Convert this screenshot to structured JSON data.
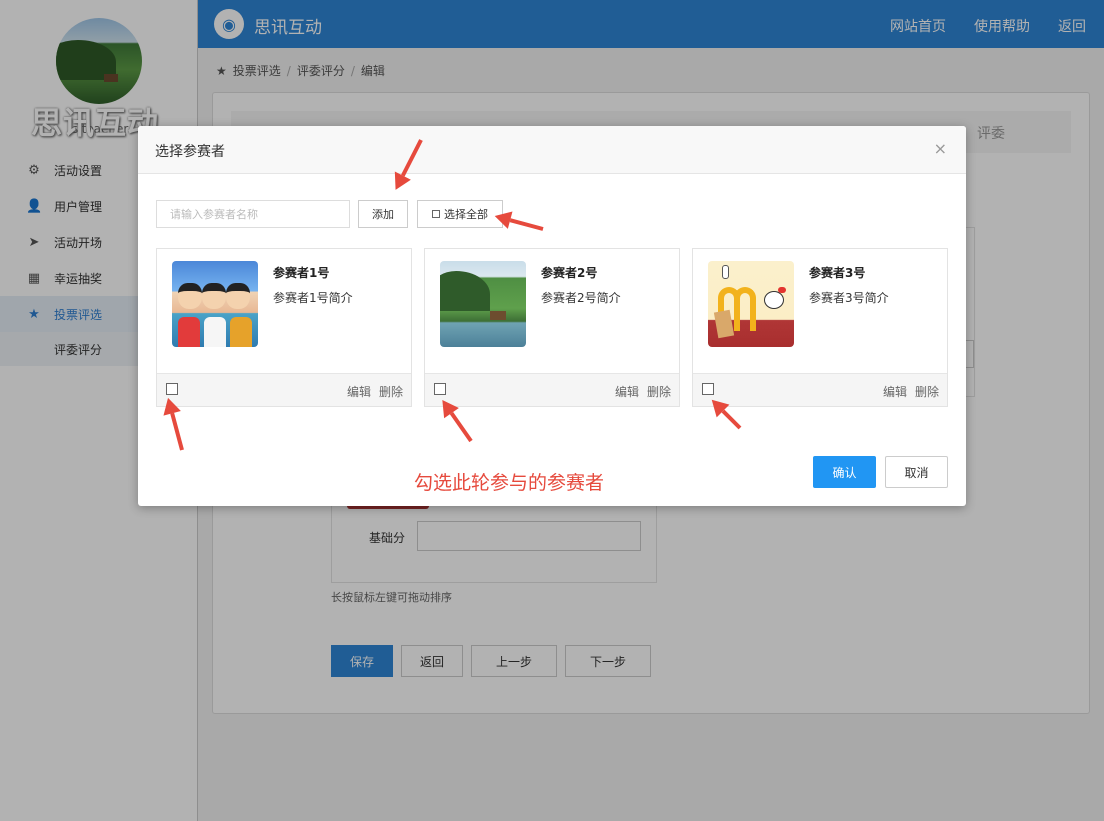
{
  "brand": {
    "watermark": "思讯互动",
    "username": "siteaener"
  },
  "sidebar": {
    "items": [
      {
        "label": "活动设置",
        "icon": "gears-icon"
      },
      {
        "label": "用户管理",
        "icon": "user-icon"
      },
      {
        "label": "活动开场",
        "icon": "send-icon"
      },
      {
        "label": "幸运抽奖",
        "icon": "lottery-icon"
      },
      {
        "label": "投票评选",
        "icon": "star-icon",
        "active": true
      },
      {
        "label": "评委评分",
        "sub": true
      }
    ]
  },
  "topbar": {
    "title": "思讯互动",
    "links": [
      "网站首页",
      "使用帮助",
      "返回"
    ],
    "color": "#2f86d6"
  },
  "breadcrumb": [
    "投票评选",
    "评委评分",
    "编辑"
  ],
  "background_form": {
    "last_step": "评委",
    "base_score_label": "基础分",
    "hint": "长按鼠标左键可拖动排序",
    "buttons": {
      "save": "保存",
      "back": "返回",
      "prev": "上一步",
      "next": "下一步"
    }
  },
  "modal": {
    "title": "选择参赛者",
    "close": "×",
    "search_placeholder": "请输入参赛者名称",
    "add_label": "添加",
    "select_all_label": "选择全部",
    "cards": [
      {
        "name": "参赛者1号",
        "desc": "参赛者1号简介",
        "edit": "编辑",
        "delete": "删除",
        "checked": false
      },
      {
        "name": "参赛者2号",
        "desc": "参赛者2号简介",
        "edit": "编辑",
        "delete": "删除",
        "checked": false
      },
      {
        "name": "参赛者3号",
        "desc": "参赛者3号简介",
        "edit": "编辑",
        "delete": "删除",
        "checked": false
      }
    ],
    "annotation": "勾选此轮参与的参赛者",
    "confirm_label": "确认",
    "cancel_label": "取消",
    "confirm_color": "#2196f3",
    "annotation_color": "#e64a3d"
  }
}
